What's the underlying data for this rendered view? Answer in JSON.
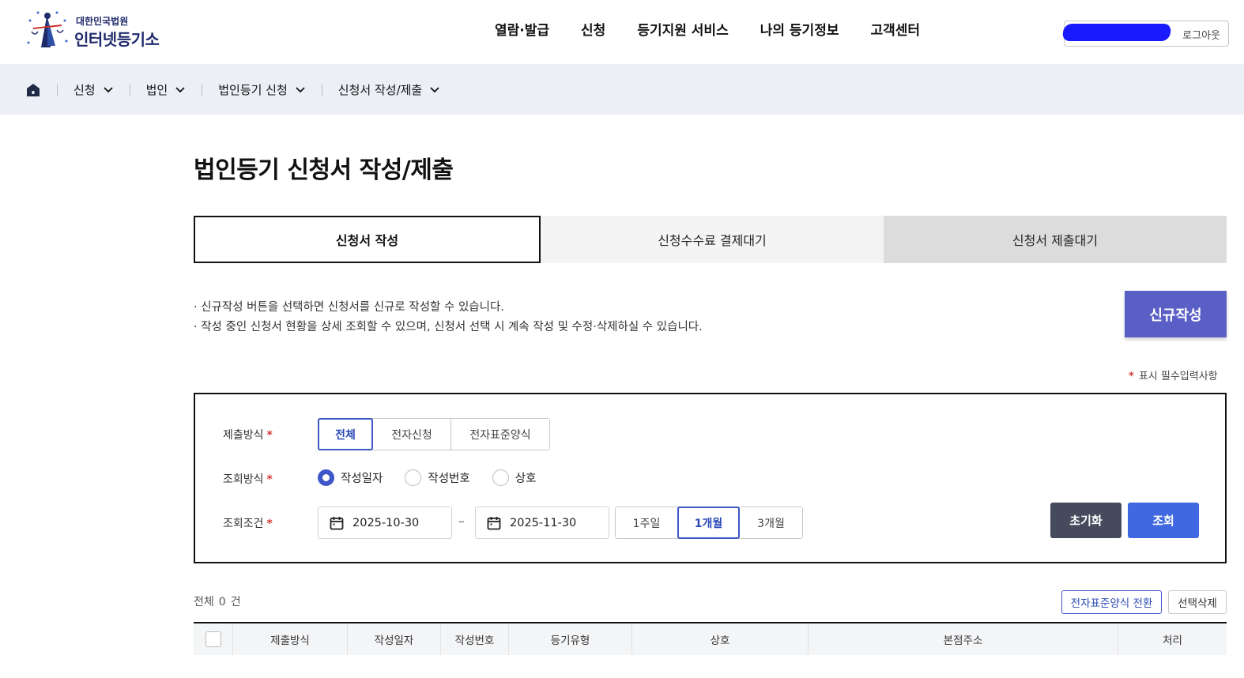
{
  "header": {
    "logo_sub": "대한민국법원",
    "logo_main": "인터넷등기소",
    "nav": [
      "열람·발급",
      "신청",
      "등기지원 서비스",
      "나의 등기정보",
      "고객센터"
    ],
    "logout": "로그아웃"
  },
  "breadcrumb": {
    "items": [
      "신청",
      "법인",
      "법인등기 신청",
      "신청서 작성/제출"
    ]
  },
  "page": {
    "title": "법인등기 신청서 작성/제출",
    "tabs": [
      "신청서 작성",
      "신청수수료 결제대기",
      "신청서 제출대기"
    ],
    "notes": [
      "· 신규작성 버튼을 선택하면 신청서를 신규로 작성할 수 있습니다.",
      "· 작성 중인 신청서 현황을 상세 조회할 수 있으며, 신청서 선택 시 계속 작성 및 수정·삭제하실 수 있습니다."
    ],
    "new_button": "신규작성",
    "required_star": "*",
    "required_note": "표시 필수입력사항"
  },
  "search": {
    "submit_label": "제출방식",
    "submit_options": [
      "전체",
      "전자신청",
      "전자표준양식"
    ],
    "submit_selected": "전체",
    "query_label": "조회방식",
    "query_options": [
      "작성일자",
      "작성번호",
      "상호"
    ],
    "query_selected": "작성일자",
    "cond_label": "조회조건",
    "date_from": "2025-10-30",
    "date_sep": "–",
    "date_to": "2025-11-30",
    "periods": [
      "1주일",
      "1개월",
      "3개월"
    ],
    "period_selected": "1개월",
    "reset": "초기화",
    "search": "조회"
  },
  "list": {
    "total_prefix": "전체",
    "total_count": "0",
    "total_suffix": "건",
    "convert_button": "전자표준양식 전환",
    "delete_button": "선택삭제",
    "columns": [
      "제출방식",
      "작성일자",
      "작성번호",
      "등기유형",
      "상호",
      "본점주소",
      "처리"
    ]
  },
  "colors": {
    "accent": "#3d56c8",
    "new_button": "#5a5fc6",
    "search_button": "#4068e0",
    "reset_button": "#454b5d",
    "required": "#d63a3a"
  }
}
